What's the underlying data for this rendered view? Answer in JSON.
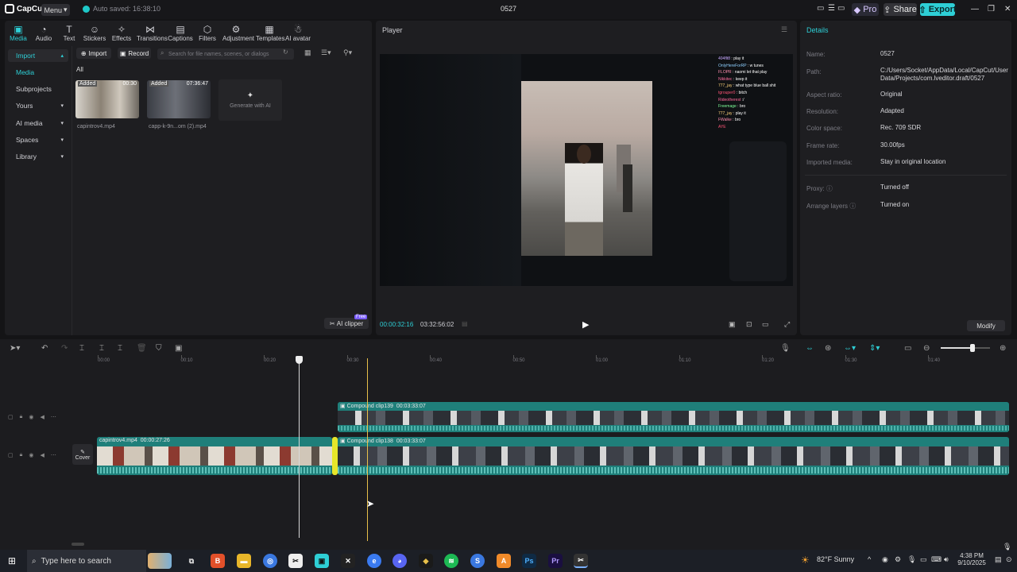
{
  "app": {
    "logo": "CapCut",
    "menu_label": "Menu",
    "autosave": "Auto saved: 16:38:10",
    "project_title": "0527"
  },
  "titlebar": {
    "pro": "Pro",
    "share": "Share",
    "export": "Export"
  },
  "tabs": [
    {
      "label": "Media",
      "icon": "media-icon"
    },
    {
      "label": "Audio",
      "icon": "audio-icon"
    },
    {
      "label": "Text",
      "icon": "text-icon"
    },
    {
      "label": "Stickers",
      "icon": "stickers-icon"
    },
    {
      "label": "Effects",
      "icon": "effects-icon"
    },
    {
      "label": "Transitions",
      "icon": "transitions-icon"
    },
    {
      "label": "Captions",
      "icon": "captions-icon"
    },
    {
      "label": "Filters",
      "icon": "filters-icon"
    },
    {
      "label": "Adjustment",
      "icon": "adjustment-icon"
    },
    {
      "label": "Templates",
      "icon": "templates-icon"
    },
    {
      "label": "AI avatar",
      "icon": "ai-avatar-icon"
    }
  ],
  "sidebar": {
    "items": [
      "Import",
      "Media",
      "Subprojects",
      "Yours",
      "AI media",
      "Spaces",
      "Library"
    ]
  },
  "media": {
    "import_btn": "Import",
    "record_btn": "Record",
    "search_placeholder": "Search for file names, scenes, or dialogs",
    "filter_all": "All",
    "items": [
      {
        "name": "capintrov4.mp4",
        "tag": "Added",
        "duration": "00:30"
      },
      {
        "name": "capp-k-9n...om (2).mp4",
        "tag": "Added",
        "duration": "07:36:47"
      }
    ],
    "generate_ai": "Generate with AI",
    "ai_clipper": "AI clipper",
    "free_badge": "Free"
  },
  "player": {
    "title": "Player",
    "current_time": "00:00:32:16",
    "total_time": "03:32:56:02",
    "chat": [
      {
        "user": "404flt8",
        "msg": "play it"
      },
      {
        "user": "OnlyHereForRP",
        "msg": "w tunes"
      },
      {
        "user": "FLOPR",
        "msg": "naomi let that play"
      },
      {
        "user": "Nikkitec",
        "msg": "keep it"
      },
      {
        "user": "777_jay",
        "msg": "what type blue ball shit"
      },
      {
        "user": "tgrouper0",
        "msg": "bitch"
      },
      {
        "user": "Rideotherest",
        "msg": ":/"
      },
      {
        "user": "Freemage",
        "msg": "bro"
      },
      {
        "user": "777_jay",
        "msg": "play it"
      },
      {
        "user": "FWalke",
        "msg": "bro"
      },
      {
        "user": "",
        "msg": "AYE"
      }
    ]
  },
  "details": {
    "title": "Details",
    "rows": [
      {
        "label": "Name:",
        "value": "0527"
      },
      {
        "label": "Path:",
        "value": "C:/Users/Socket/AppData/Local/CapCut/User Data/Projects/com.lveditor.draft/0527"
      },
      {
        "label": "Aspect ratio:",
        "value": "Original"
      },
      {
        "label": "Resolution:",
        "value": "Adapted"
      },
      {
        "label": "Color space:",
        "value": "Rec. 709 SDR"
      },
      {
        "label": "Frame rate:",
        "value": "30.00fps"
      },
      {
        "label": "Imported media:",
        "value": "Stay in original location"
      },
      {
        "label": "Proxy:",
        "value": "Turned off"
      },
      {
        "label": "Arrange layers",
        "value": "Turned on"
      }
    ],
    "modify": "Modify"
  },
  "timeline": {
    "ticks": [
      "00:00",
      "00:10",
      "00:20",
      "00:30",
      "00:40",
      "00:50",
      "01:00",
      "01:10",
      "01:20",
      "01:30",
      "01:40"
    ],
    "clips": [
      {
        "name": "Compound clip139",
        "duration": "00:03:33:07"
      },
      {
        "name": "capintrov4.mp4",
        "duration": "00:00:27:26"
      },
      {
        "name": "Compound clip138",
        "duration": "00:03:33:07"
      }
    ],
    "cover_label": "Cover",
    "zoom_level": 0.65
  },
  "taskbar": {
    "search_placeholder": "Type here to search",
    "weather": "82°F  Sunny",
    "time": "4:38 PM",
    "date": "9/10/2025"
  },
  "colors": {
    "accent": "#2ecfd6",
    "clip_teal": "#1f7f7a",
    "playhead": "#e8c04a"
  }
}
